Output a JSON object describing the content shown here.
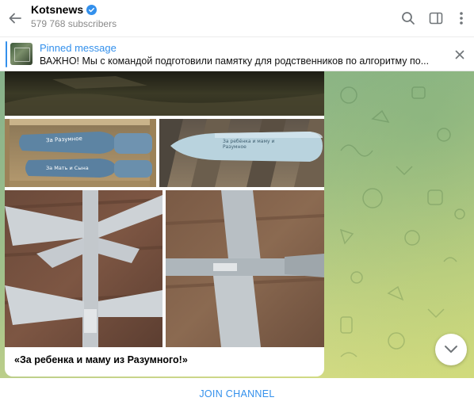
{
  "header": {
    "channel_name": "Kotsnews",
    "subscribers": "579 768 subscribers",
    "back_icon": "arrow-left-icon",
    "search_icon": "search-icon",
    "sidebar_icon": "sidebar-toggle-icon",
    "menu_icon": "more-vertical-icon"
  },
  "pinned": {
    "title": "Pinned message",
    "text": "ВАЖНО!  Мы с командой подготовили памятку для родственников по алгоритму по..."
  },
  "message": {
    "caption": "«За ребенка и маму из Разумного!»",
    "photo_texts": {
      "p2_a": "За Разумное",
      "p2_b": "За Мать и Сына",
      "p3": "За ребёнка и маму и Разумное"
    }
  },
  "footer": {
    "join_label": "JOIN CHANNEL"
  },
  "colors": {
    "accent": "#3390ec",
    "background_gradient_start": "#86b08a",
    "background_gradient_end": "#d6db8a"
  }
}
